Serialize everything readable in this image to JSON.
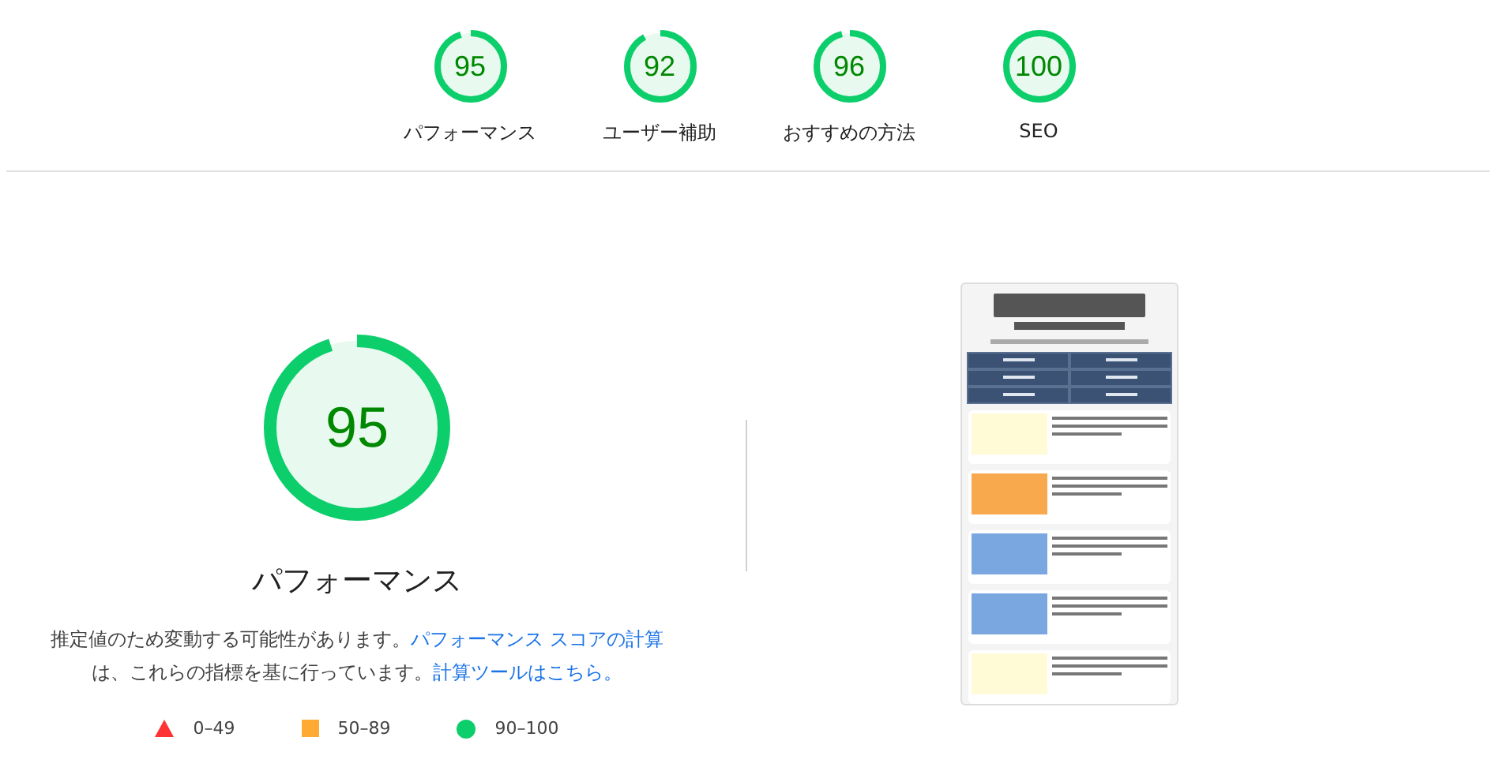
{
  "categories": [
    {
      "label": "パフォーマンス",
      "score": "95",
      "level": 0.95
    },
    {
      "label": "ユーザー補助",
      "score": "92",
      "level": 0.92
    },
    {
      "label": "おすすめの方法",
      "score": "96",
      "level": 0.96
    },
    {
      "label": "SEO",
      "score": "100",
      "level": 1.0
    }
  ],
  "main": {
    "score": "95",
    "level": 0.95,
    "title": "パフォーマンス",
    "description": [
      {
        "kind": "text",
        "text": "推定値のため変動する可能性があります。"
      },
      {
        "kind": "link",
        "text": "パフォーマンス スコアの計算"
      },
      {
        "kind": "text",
        "text": "は、これらの指標を基に行っています。"
      },
      {
        "kind": "link",
        "text": "計算ツールはこちら。"
      }
    ],
    "legend": [
      {
        "kind": "triangle",
        "color": "#ff3333",
        "text": "0–49"
      },
      {
        "kind": "square",
        "color": "#ffaa33",
        "text": "50–89"
      },
      {
        "kind": "circle",
        "color": "#0cce6b",
        "text": "90–100"
      }
    ]
  }
}
